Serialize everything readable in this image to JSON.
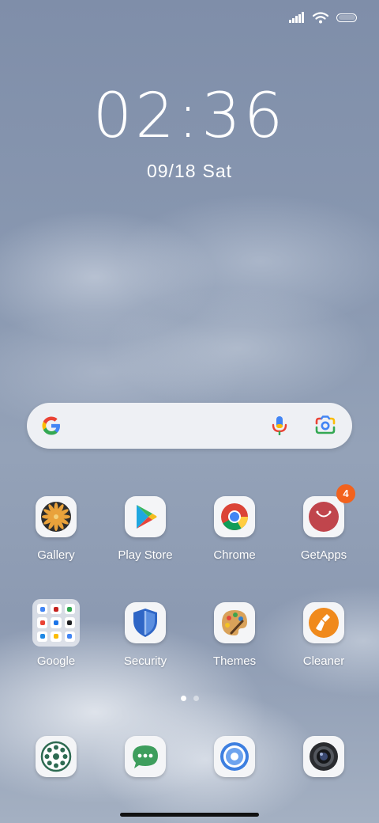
{
  "status_bar": {
    "signal_icon": "signal-icon",
    "wifi_icon": "wifi-icon",
    "battery_icon": "battery-icon"
  },
  "lockscreen": {
    "time": "02:36",
    "date": "09/18",
    "weekday": "Sat"
  },
  "search_widget": {
    "logo_icon": "google-g-icon",
    "voice_icon": "microphone-icon",
    "lens_icon": "google-lens-icon"
  },
  "apps_row1": [
    {
      "label": "Gallery",
      "icon": "gallery-icon"
    },
    {
      "label": "Play Store",
      "icon": "play-store-icon"
    },
    {
      "label": "Chrome",
      "icon": "chrome-icon"
    },
    {
      "label": "GetApps",
      "icon": "getapps-icon",
      "badge": "4"
    }
  ],
  "apps_row2": [
    {
      "label": "Google",
      "icon": "folder-icon"
    },
    {
      "label": "Security",
      "icon": "security-shield-icon"
    },
    {
      "label": "Themes",
      "icon": "themes-palette-icon"
    },
    {
      "label": "Cleaner",
      "icon": "cleaner-brush-icon"
    }
  ],
  "page_indicator": {
    "pages": 2,
    "active": 1
  },
  "dock": [
    {
      "icon": "phone-dialer-icon"
    },
    {
      "icon": "messages-icon"
    },
    {
      "icon": "browser-icon"
    },
    {
      "icon": "camera-icon"
    }
  ],
  "colors": {
    "badge": "#f2621d",
    "getapps": "#c0454c",
    "cleaner": "#f08a1c",
    "security": "#2f66c6",
    "phone_green": "#2e6b52"
  }
}
